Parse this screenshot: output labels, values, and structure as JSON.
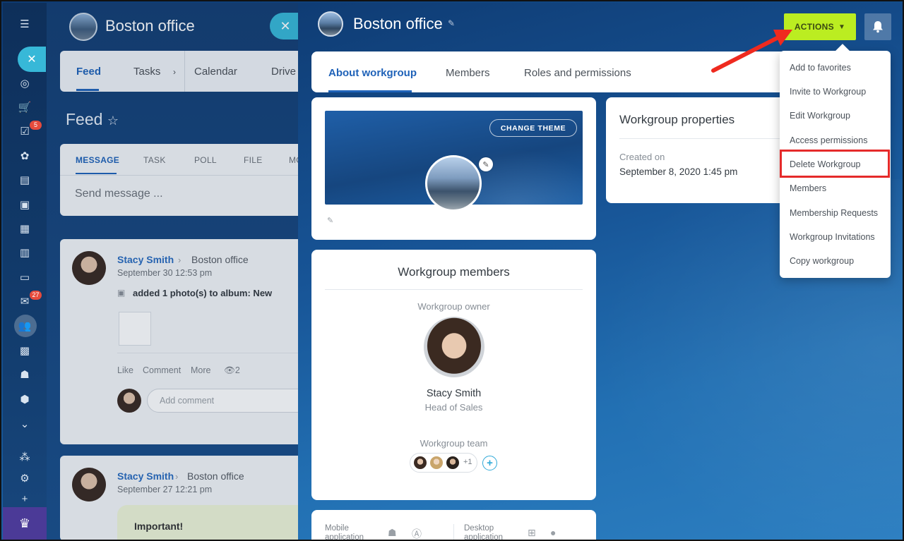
{
  "background": {
    "title": "Boston office",
    "tabs": [
      "Feed",
      "Tasks",
      "Calendar",
      "Drive"
    ],
    "feed_title": "Feed",
    "composer_tabs": [
      "MESSAGE",
      "TASK",
      "POLL",
      "FILE",
      "MO"
    ],
    "composer_placeholder": "Send message ...",
    "posts": [
      {
        "author": "Stacy Smith",
        "group": "Boston office",
        "date": "September 30 12:53 pm",
        "text": "added 1 photo(s) to album: New",
        "actions": [
          "Like",
          "Comment",
          "More"
        ],
        "views": "2",
        "comment_placeholder": "Add comment"
      },
      {
        "author": "Stacy Smith",
        "group": "Boston office",
        "date": "September 27 12:21 pm",
        "text": "Important!"
      }
    ]
  },
  "rail": {
    "badges": {
      "tasks": "5",
      "mail": "27"
    }
  },
  "slider": {
    "title": "Boston office",
    "actions_label": "ACTIONS",
    "tabs": [
      "About workgroup",
      "Members",
      "Roles and permissions"
    ],
    "theme": {
      "change_theme_label": "CHANGE THEME"
    },
    "properties": {
      "title": "Workgroup properties",
      "created_label": "Created on",
      "created_value": "September 8, 2020 1:45 pm"
    },
    "members": {
      "title": "Workgroup members",
      "owner_label": "Workgroup owner",
      "owner_name": "Stacy Smith",
      "owner_role": "Head of Sales",
      "team_label": "Workgroup team",
      "team_more": "+1"
    },
    "apps": {
      "mobile_label": "Mobile application",
      "desktop_label": "Desktop application"
    }
  },
  "actions_menu": {
    "items": [
      "Add to favorites",
      "Invite to Workgroup",
      "Edit Workgroup",
      "Access permissions",
      "Delete Workgroup",
      "Members",
      "Membership Requests",
      "Workgroup Invitations",
      "Copy workgroup"
    ],
    "highlighted": "Delete Workgroup"
  },
  "colors": {
    "actions_button": "#bbed21",
    "highlight_box": "#e52a2a",
    "accent_blue": "#1f62b8"
  }
}
